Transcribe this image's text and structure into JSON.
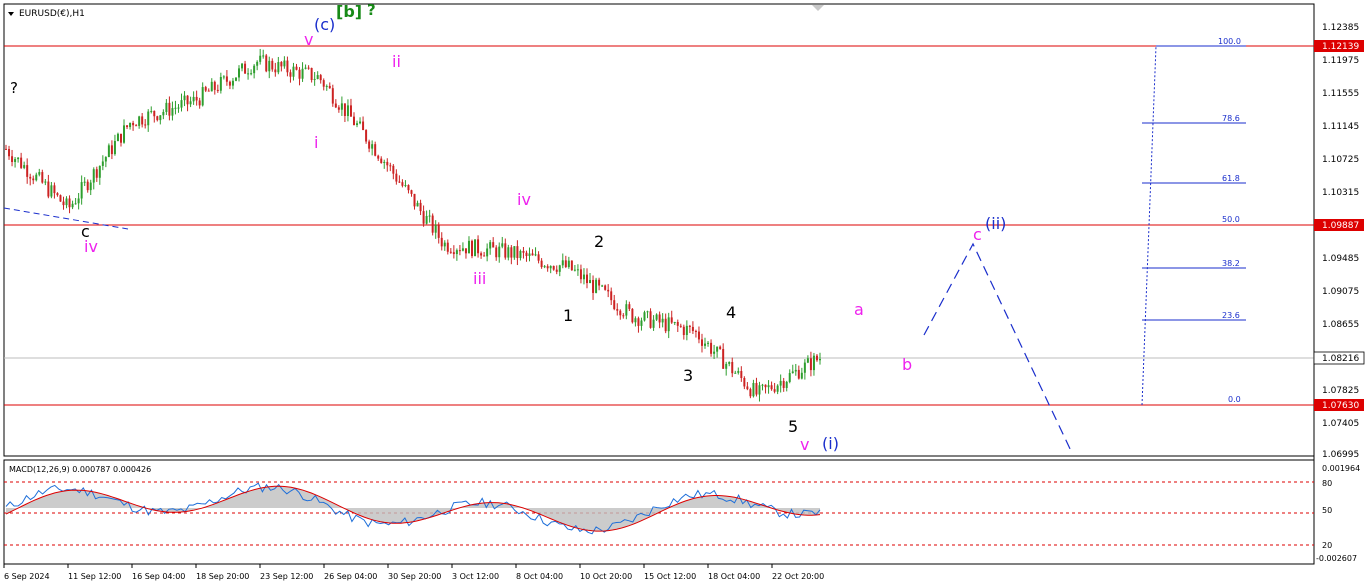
{
  "header": {
    "symbol_label": "EURUSD(€),H1"
  },
  "macd_panel": {
    "label": "MACD(12,26,9) 0.000787 0.000426",
    "right_labels": [
      "0.001964",
      "80",
      "50",
      "20",
      "-0.002607"
    ],
    "rsi_levels": [
      80,
      50,
      20
    ]
  },
  "price_axis": {
    "ticks": [
      "1.12385",
      "1.11975",
      "1.11555",
      "1.11145",
      "1.10725",
      "1.10315",
      "1.09485",
      "1.09075",
      "1.08655",
      "1.07825",
      "1.07405",
      "1.06995"
    ],
    "highlighted": [
      {
        "value": "1.12139",
        "color": "#dd0000"
      },
      {
        "value": "1.09887",
        "color": "#dd0000"
      },
      {
        "value": "1.08216",
        "color": "#ffffff"
      },
      {
        "value": "1.07630",
        "color": "#dd0000"
      }
    ]
  },
  "time_axis": [
    "6 Sep 2024",
    "11 Sep 12:00",
    "16 Sep 04:00",
    "18 Sep 20:00",
    "23 Sep 12:00",
    "26 Sep 04:00",
    "30 Sep 20:00",
    "3 Oct 12:00",
    "8 Oct 04:00",
    "10 Oct 20:00",
    "15 Oct 12:00",
    "18 Oct 04:00",
    "22 Oct 20:00"
  ],
  "fib_levels": [
    "100.0",
    "78.6",
    "61.8",
    "50.0",
    "38.2",
    "23.6",
    "0.0"
  ],
  "wave_labels": {
    "c_black": "c",
    "iv_left": "iv",
    "q_left": "?",
    "v_top": "v",
    "c_paren": "(c)",
    "b_bracket": "[b]",
    "q_top": "?",
    "i_small": "i",
    "ii_small": "ii",
    "iii_small": "iii",
    "iv_small": "iv",
    "w1": "1",
    "w2": "2",
    "w3": "3",
    "w4": "4",
    "w5": "5",
    "v_bottom": "v",
    "i_paren": "(i)",
    "a_label": "a",
    "b_label": "b",
    "c_label": "c",
    "ii_paren": "(ii)"
  },
  "colors": {
    "bull": "#2e9e2e",
    "bear": "#cc2222",
    "magenta": "#ee22ee",
    "blue": "#1a2ecc",
    "green": "#178a17",
    "red_line": "#dd0000"
  },
  "chart_data": {
    "type": "candlestick",
    "title": "EURUSD(€),H1",
    "ylim": [
      1.06995,
      1.12385
    ],
    "levels": [
      1.12139,
      1.09887,
      1.08216,
      1.0763
    ],
    "fibonacci": [
      {
        "label": "100.0",
        "value": 1.12139
      },
      {
        "label": "78.6",
        "value": 1.1118
      },
      {
        "label": "61.8",
        "value": 1.1043
      },
      {
        "label": "50.0",
        "value": 1.09887
      },
      {
        "label": "38.2",
        "value": 1.0936
      },
      {
        "label": "23.6",
        "value": 1.087
      },
      {
        "label": "0.0",
        "value": 1.0763
      }
    ],
    "price_path": [
      {
        "x": "6 Sep 2024",
        "y": 1.1085
      },
      {
        "x": "11 Sep 12:00",
        "y": 1.101
      },
      {
        "x": "16 Sep 04:00",
        "y": 1.112
      },
      {
        "x": "18 Sep 20:00",
        "y": 1.1145
      },
      {
        "x": "23 Sep 12:00",
        "y": 1.1195
      },
      {
        "x": "26 Sep 04:00",
        "y": 1.1175
      },
      {
        "x": "30 Sep 20:00",
        "y": 1.1075
      },
      {
        "x": "3 Oct 12:00",
        "y": 1.0965
      },
      {
        "x": "8 Oct 04:00",
        "y": 1.0955
      },
      {
        "x": "10 Oct 20:00",
        "y": 1.0935
      },
      {
        "x": "15 Oct 12:00",
        "y": 1.0875
      },
      {
        "x": "18 Oct 04:00",
        "y": 1.0855
      },
      {
        "x": "22 Oct 20:00",
        "y": 1.0775
      },
      {
        "x": "end",
        "y": 1.0822
      }
    ]
  }
}
